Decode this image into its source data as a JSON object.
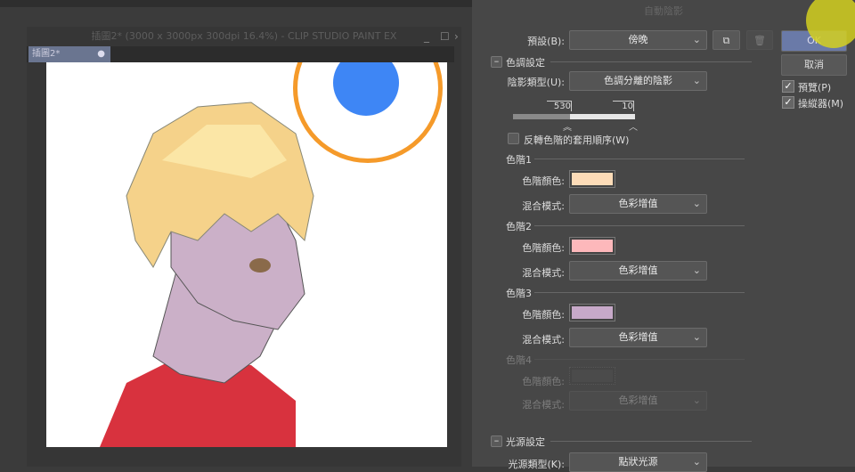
{
  "window": {
    "title": "插圖2* (3000 x 3000px 300dpi 16.4%) - CLIP STUDIO PAINT EX",
    "tab": "插圖2*"
  },
  "dialog": {
    "title": "自動陰影",
    "preset_label": "預設(B):",
    "preset_value": "傍晚",
    "ok": "OK",
    "cancel": "取消",
    "preview": "預覽(P)",
    "manipulator": "操縱器(M)",
    "tone_section": "色調設定",
    "shadow_type_label": "陰影類型(U):",
    "shadow_type_value": "色調分離的陰影",
    "slider_values": [
      "530",
      "10"
    ],
    "reverse_label": "反轉色階的套用順序(W)",
    "levels": [
      {
        "name": "色階1",
        "color_label": "色階顏色:",
        "color": "#fddcb8",
        "blend_label": "混合模式:",
        "blend": "色彩增值",
        "enabled": true
      },
      {
        "name": "色階2",
        "color_label": "色階顏色:",
        "color": "#fdb8bb",
        "blend_label": "混合模式:",
        "blend": "色彩增值",
        "enabled": true
      },
      {
        "name": "色階3",
        "color_label": "色階顏色:",
        "color": "#c7a9c9",
        "blend_label": "混合模式:",
        "blend": "色彩增值",
        "enabled": true
      },
      {
        "name": "色階4",
        "color_label": "色階顏色:",
        "color": "#555555",
        "blend_label": "混合模式:",
        "blend": "色彩增值",
        "enabled": false
      }
    ],
    "light_section": "光源設定",
    "light_type_label": "光源類型(K):",
    "light_type_value": "點狀光源"
  },
  "colors": {
    "accent": "#6a7aa8",
    "cursor": "#d4d020",
    "light_ring": "#f59a2a",
    "light_dot": "#3e86f5"
  }
}
